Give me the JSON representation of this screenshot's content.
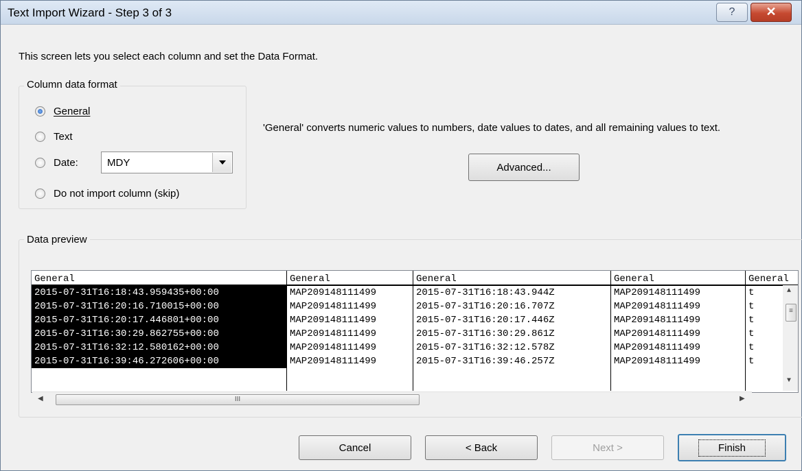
{
  "window": {
    "title": "Text Import Wizard - Step 3 of 3",
    "help_label": "?",
    "close_label": "✕"
  },
  "intro": "This screen lets you select each column and set the Data Format.",
  "column_format": {
    "legend": "Column data format",
    "options": [
      {
        "label": "General",
        "checked": true
      },
      {
        "label": "Text",
        "checked": false
      },
      {
        "label": "Date:",
        "checked": false
      },
      {
        "label": "Do not import column (skip)",
        "checked": false
      }
    ],
    "date_value": "MDY"
  },
  "description": "'General' converts numeric values to numbers, date values to dates, and all remaining values to text.",
  "advanced_label": "Advanced...",
  "preview": {
    "legend": "Data preview",
    "headers": [
      "General",
      "General",
      "General",
      "General",
      "General"
    ],
    "columns": [
      [
        "2015-07-31T16:18:43.959435+00:00",
        "2015-07-31T16:20:16.710015+00:00",
        "2015-07-31T16:20:17.446801+00:00",
        "2015-07-31T16:30:29.862755+00:00",
        "2015-07-31T16:32:12.580162+00:00",
        "2015-07-31T16:39:46.272606+00:00"
      ],
      [
        "MAP209148111499",
        "MAP209148111499",
        "MAP209148111499",
        "MAP209148111499",
        "MAP209148111499",
        "MAP209148111499"
      ],
      [
        "2015-07-31T16:18:43.944Z",
        "2015-07-31T16:20:16.707Z",
        "2015-07-31T16:20:17.446Z",
        "2015-07-31T16:30:29.861Z",
        "2015-07-31T16:32:12.578Z",
        "2015-07-31T16:39:46.257Z"
      ],
      [
        "MAP209148111499",
        "MAP209148111499",
        "MAP209148111499",
        "MAP209148111499",
        "MAP209148111499",
        "MAP209148111499"
      ],
      [
        "t",
        "t",
        "t",
        "t",
        "t",
        "t"
      ]
    ],
    "selected_column": 0,
    "scroll_grip": "III"
  },
  "buttons": {
    "cancel": "Cancel",
    "back": "< Back",
    "next": "Next >",
    "finish": "Finish"
  },
  "icons": {
    "dropdown": "chevron-down-icon",
    "scroll_left": "left-arrow-icon",
    "scroll_right": "right-arrow-icon",
    "scroll_up": "up-arrow-icon",
    "scroll_down": "down-arrow-icon"
  }
}
